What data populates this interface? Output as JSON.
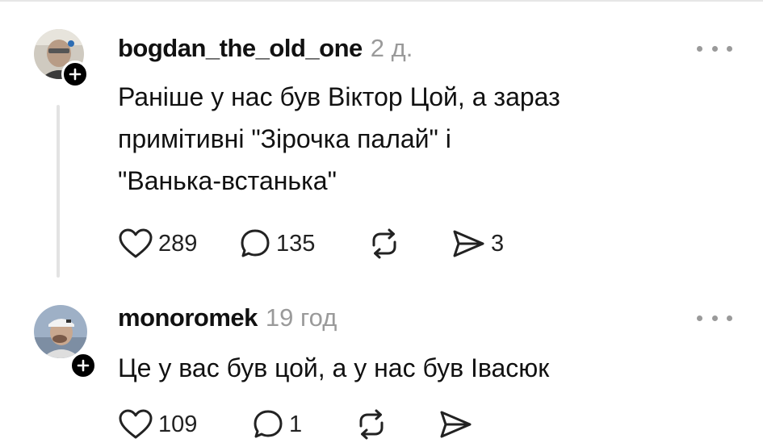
{
  "posts": [
    {
      "username": "bogdan_the_old_one",
      "time": "2 д.",
      "text_lines": [
        "Раніше у нас був Віктор Цой, а зараз",
        "примітивні \"Зірочка палай\" і",
        "\"Ванька-встанька\""
      ],
      "likes": "289",
      "replies": "135",
      "shares": "3"
    },
    {
      "username": "monoromek",
      "time": "19 год",
      "text_lines": [
        "Це у вас був цой, а у нас був Івасюк"
      ],
      "likes": "109",
      "replies": "1"
    }
  ],
  "icons": {
    "like": "heart-icon",
    "reply": "speech-bubble-icon",
    "repost": "repost-arrows-icon",
    "share": "send-icon",
    "more": "ellipsis-icon",
    "follow": "plus-icon"
  },
  "colors": {
    "text": "#111111",
    "muted": "#9a9a9a",
    "badge": "#000000",
    "thread_line": "#e3e3e3"
  }
}
